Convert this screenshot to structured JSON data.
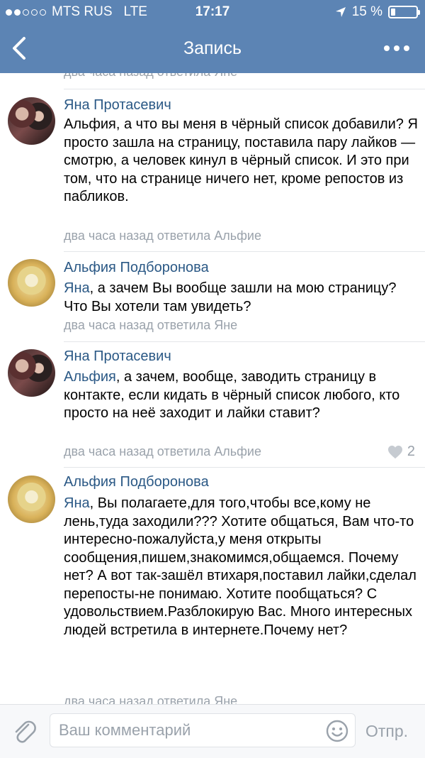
{
  "status_bar": {
    "carrier": "MTS RUS",
    "network": "LTE",
    "time": "17:17",
    "battery": "15 %"
  },
  "header": {
    "title": "Запись"
  },
  "partial_meta": "два часа назад ответила Яне",
  "comments": [
    {
      "author": "Яна Протасевич",
      "mention": "",
      "text": "Альфия, а что вы меня в чёрный список добавили? Я просто зашла на страницу, поставила пару лайков — смотрю, а человек кинул в чёрный список. И это при том, что на странице ничего нет, кроме репостов из пабликов.",
      "meta": "два часа назад ответила Альфие",
      "likes": ""
    },
    {
      "author": "Альфия Подборонова",
      "mention": "Яна",
      "text": ", а зачем Вы вообще зашли на мою страницу? Что Вы хотели там увидеть?",
      "meta": "два часа назад ответила Яне",
      "likes": ""
    },
    {
      "author": "Яна Протасевич",
      "mention": "Альфия",
      "text": ", а зачем, вообще, заводить страницу в контакте, если кидать в чёрный список любого, кто просто на неё заходит и лайки ставит?",
      "meta": "два часа назад ответила Альфие",
      "likes": "2"
    },
    {
      "author": "Альфия Подборонова",
      "mention": "Яна",
      "text": ", Вы полагаете,для того,чтобы все,кому не лень,туда заходили??? Хотите общаться, Вам что-то интересно-пожалуйста,у меня открыты сообщения,пишем,знакомимся,общаемся. Почему нет? А вот так-зашёл втихаря,поставил лайки,сделал перепосты-не понимаю. Хотите пообщаться? С удовольствием.Разблокирую Вас. Много интересных людей встретила в интернете.Почему нет?",
      "meta": "два часа назад ответила Яне",
      "likes": ""
    }
  ],
  "composer": {
    "placeholder": "Ваш комментарий",
    "send_label": "Отпр."
  },
  "colors": {
    "header": "#5c84b4",
    "link": "#2a5885",
    "muted": "#9aa2ab"
  }
}
